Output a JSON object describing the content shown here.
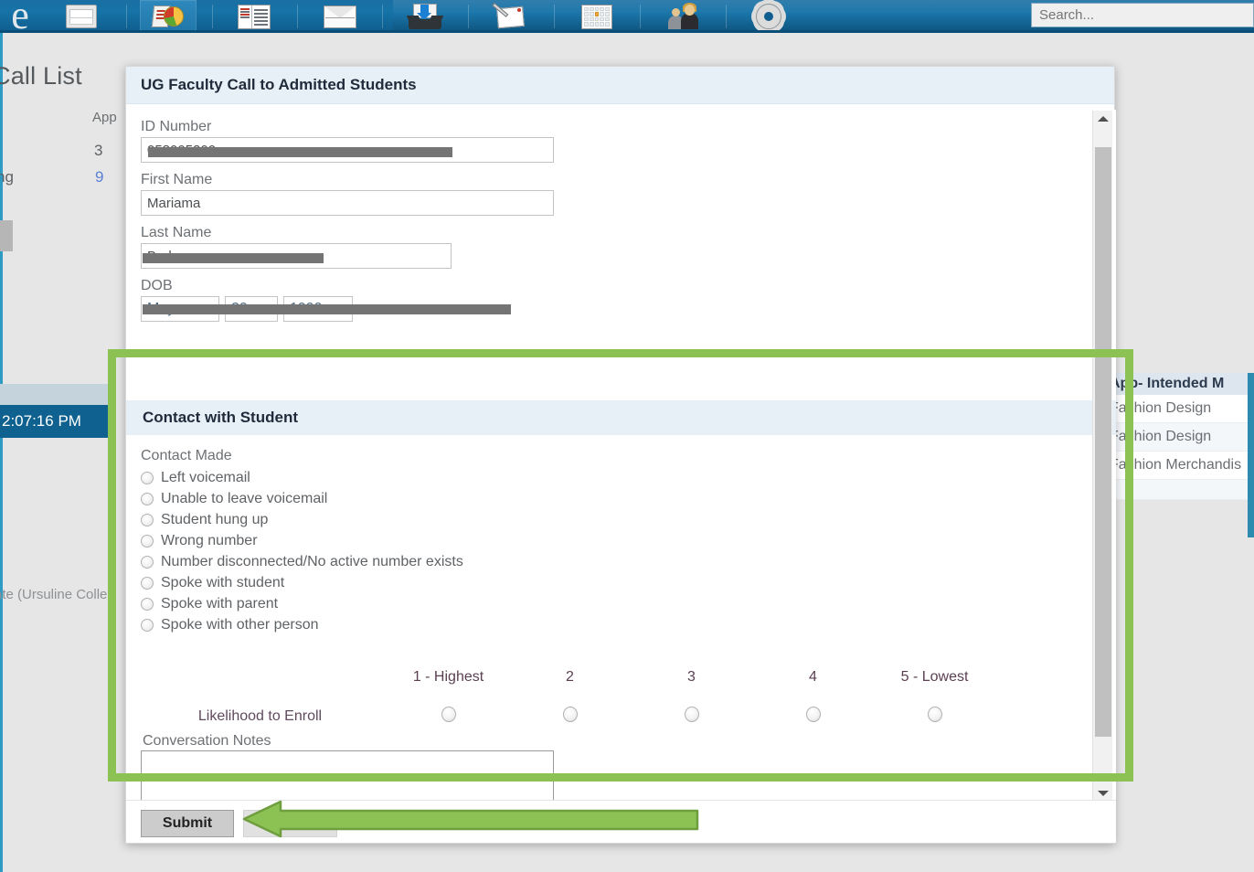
{
  "toolbar": {
    "logo": "e",
    "icons": [
      {
        "name": "page-icon",
        "label": "Page"
      },
      {
        "name": "report-pie-icon",
        "label": "Reports"
      },
      {
        "name": "document-list-icon",
        "label": "Documents"
      },
      {
        "name": "mail-envelope-icon",
        "label": "Mail"
      },
      {
        "name": "inbox-download-icon",
        "label": "Inbox"
      },
      {
        "name": "note-pen-icon",
        "label": "Notes"
      },
      {
        "name": "calendar-icon",
        "label": "Calendar"
      },
      {
        "name": "people-contacts-icon",
        "label": "Contacts"
      },
      {
        "name": "gear-settings-icon",
        "label": "Settings"
      }
    ],
    "search_placeholder": "Search...",
    "search_value": ""
  },
  "background": {
    "page_title": "Call List",
    "column_app_header": "App",
    "cell_count_3": "3",
    "cell_count_9": "9",
    "fragment_ng": "ng",
    "selected_time": "2:07:16 PM",
    "footer_fragment": "ate (Ursuline Colleg",
    "right_table": {
      "header": "App- Intended M",
      "rows": [
        "Fashion Design",
        "Fashion Design",
        "Fashion Merchandis"
      ]
    }
  },
  "modal": {
    "title": "UG Faculty Call to Admitted Students",
    "fields": {
      "id_number_label": "ID Number",
      "id_number_value": "058005200",
      "first_name_label": "First Name",
      "first_name_value": "Mariama",
      "last_name_label": "Last Name",
      "last_name_value": "Brahma",
      "dob_label": "DOB",
      "dob_month": "May",
      "dob_day": "20",
      "dob_year": "1999"
    },
    "contact_section": {
      "title": "Contact with Student",
      "contact_made_label": "Contact Made",
      "options": [
        "Left voicemail",
        "Unable to leave voicemail",
        "Student hung up",
        "Wrong number",
        "Number disconnected/No active number exists",
        "Spoke with student",
        "Spoke with parent",
        "Spoke with other person"
      ],
      "likelihood_row_label": "Likelihood to Enroll",
      "likelihood_headers": [
        "1 - Highest",
        "2",
        "3",
        "4",
        "5 - Lowest"
      ],
      "notes_label": "Conversation Notes",
      "notes_value": ""
    },
    "footer": {
      "submit_label": "Submit"
    },
    "scrollbar": {
      "up_arrow": "▲",
      "down_arrow": "▼"
    }
  },
  "annotations": {
    "highlight_color": "#8cc153",
    "box_name": "contact-with-student-highlight",
    "arrow_name": "submit-pointer-arrow"
  }
}
